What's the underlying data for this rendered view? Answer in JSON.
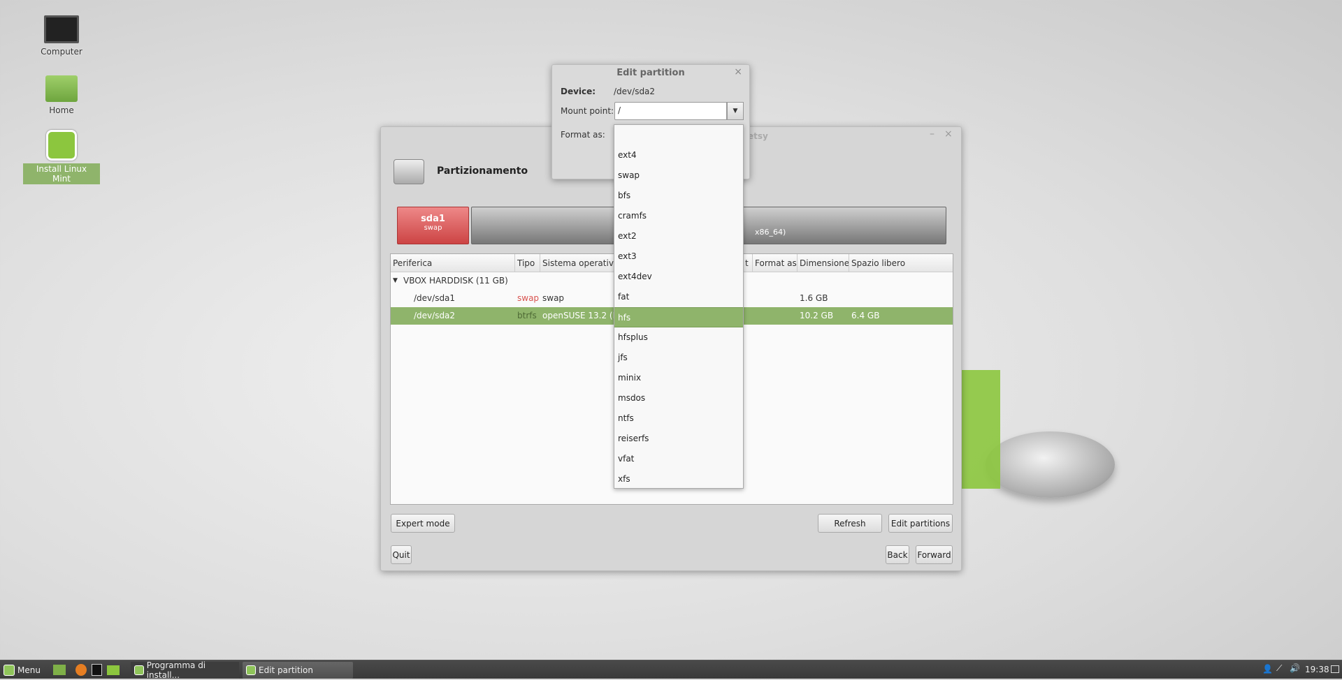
{
  "desktop": {
    "icons": [
      {
        "label": "Computer",
        "icon": "computer-icon"
      },
      {
        "label": "Home",
        "icon": "home-folder-icon"
      },
      {
        "label": "Install Linux Mint",
        "icon": "linux-mint-icon"
      }
    ]
  },
  "installer": {
    "title_partial": "etsy",
    "heading": "Partizionamento",
    "bar": [
      {
        "name": "sda1",
        "sub": "swap"
      },
      {
        "name": "",
        "sub": "x86_64)"
      }
    ],
    "columns": [
      "Periferica",
      "Tipo",
      "Sistema operativo",
      "t",
      "Format as",
      "Dimensione",
      "Spazio libero"
    ],
    "disk": "VBOX HARDDISK (11 GB)",
    "rows": [
      {
        "device": "/dev/sda1",
        "type": "swap",
        "os": "swap",
        "size": "1.6 GB",
        "free": ""
      },
      {
        "device": "/dev/sda2",
        "type": "btrfs",
        "os": "openSUSE 13.2 (H",
        "size": "10.2 GB",
        "free": "6.4 GB"
      }
    ],
    "buttons": {
      "expert": "Expert mode",
      "refresh": "Refresh",
      "edit": "Edit partitions",
      "quit": "Quit",
      "back": "Back",
      "forward": "Forward"
    },
    "colors": {
      "swap": "#d9534f",
      "selection": "#8fb46b",
      "sda1_bar": "#d65a5a"
    }
  },
  "dialog": {
    "title": "Edit partition",
    "device_label": "Device:",
    "device_value": "/dev/sda2",
    "mount_label": "Mount point:",
    "mount_value": "/",
    "format_label": "Format as:",
    "options": [
      "",
      "ext4",
      "swap",
      "bfs",
      "cramfs",
      "ext2",
      "ext3",
      "ext4dev",
      "fat",
      "hfs",
      "hfsplus",
      "jfs",
      "minix",
      "msdos",
      "ntfs",
      "reiserfs",
      "vfat",
      "xfs"
    ],
    "highlighted": "hfs"
  },
  "taskbar": {
    "menu": "Menu",
    "tasks": [
      "Programma di install...",
      "Edit partition"
    ],
    "clock": "19:38"
  }
}
